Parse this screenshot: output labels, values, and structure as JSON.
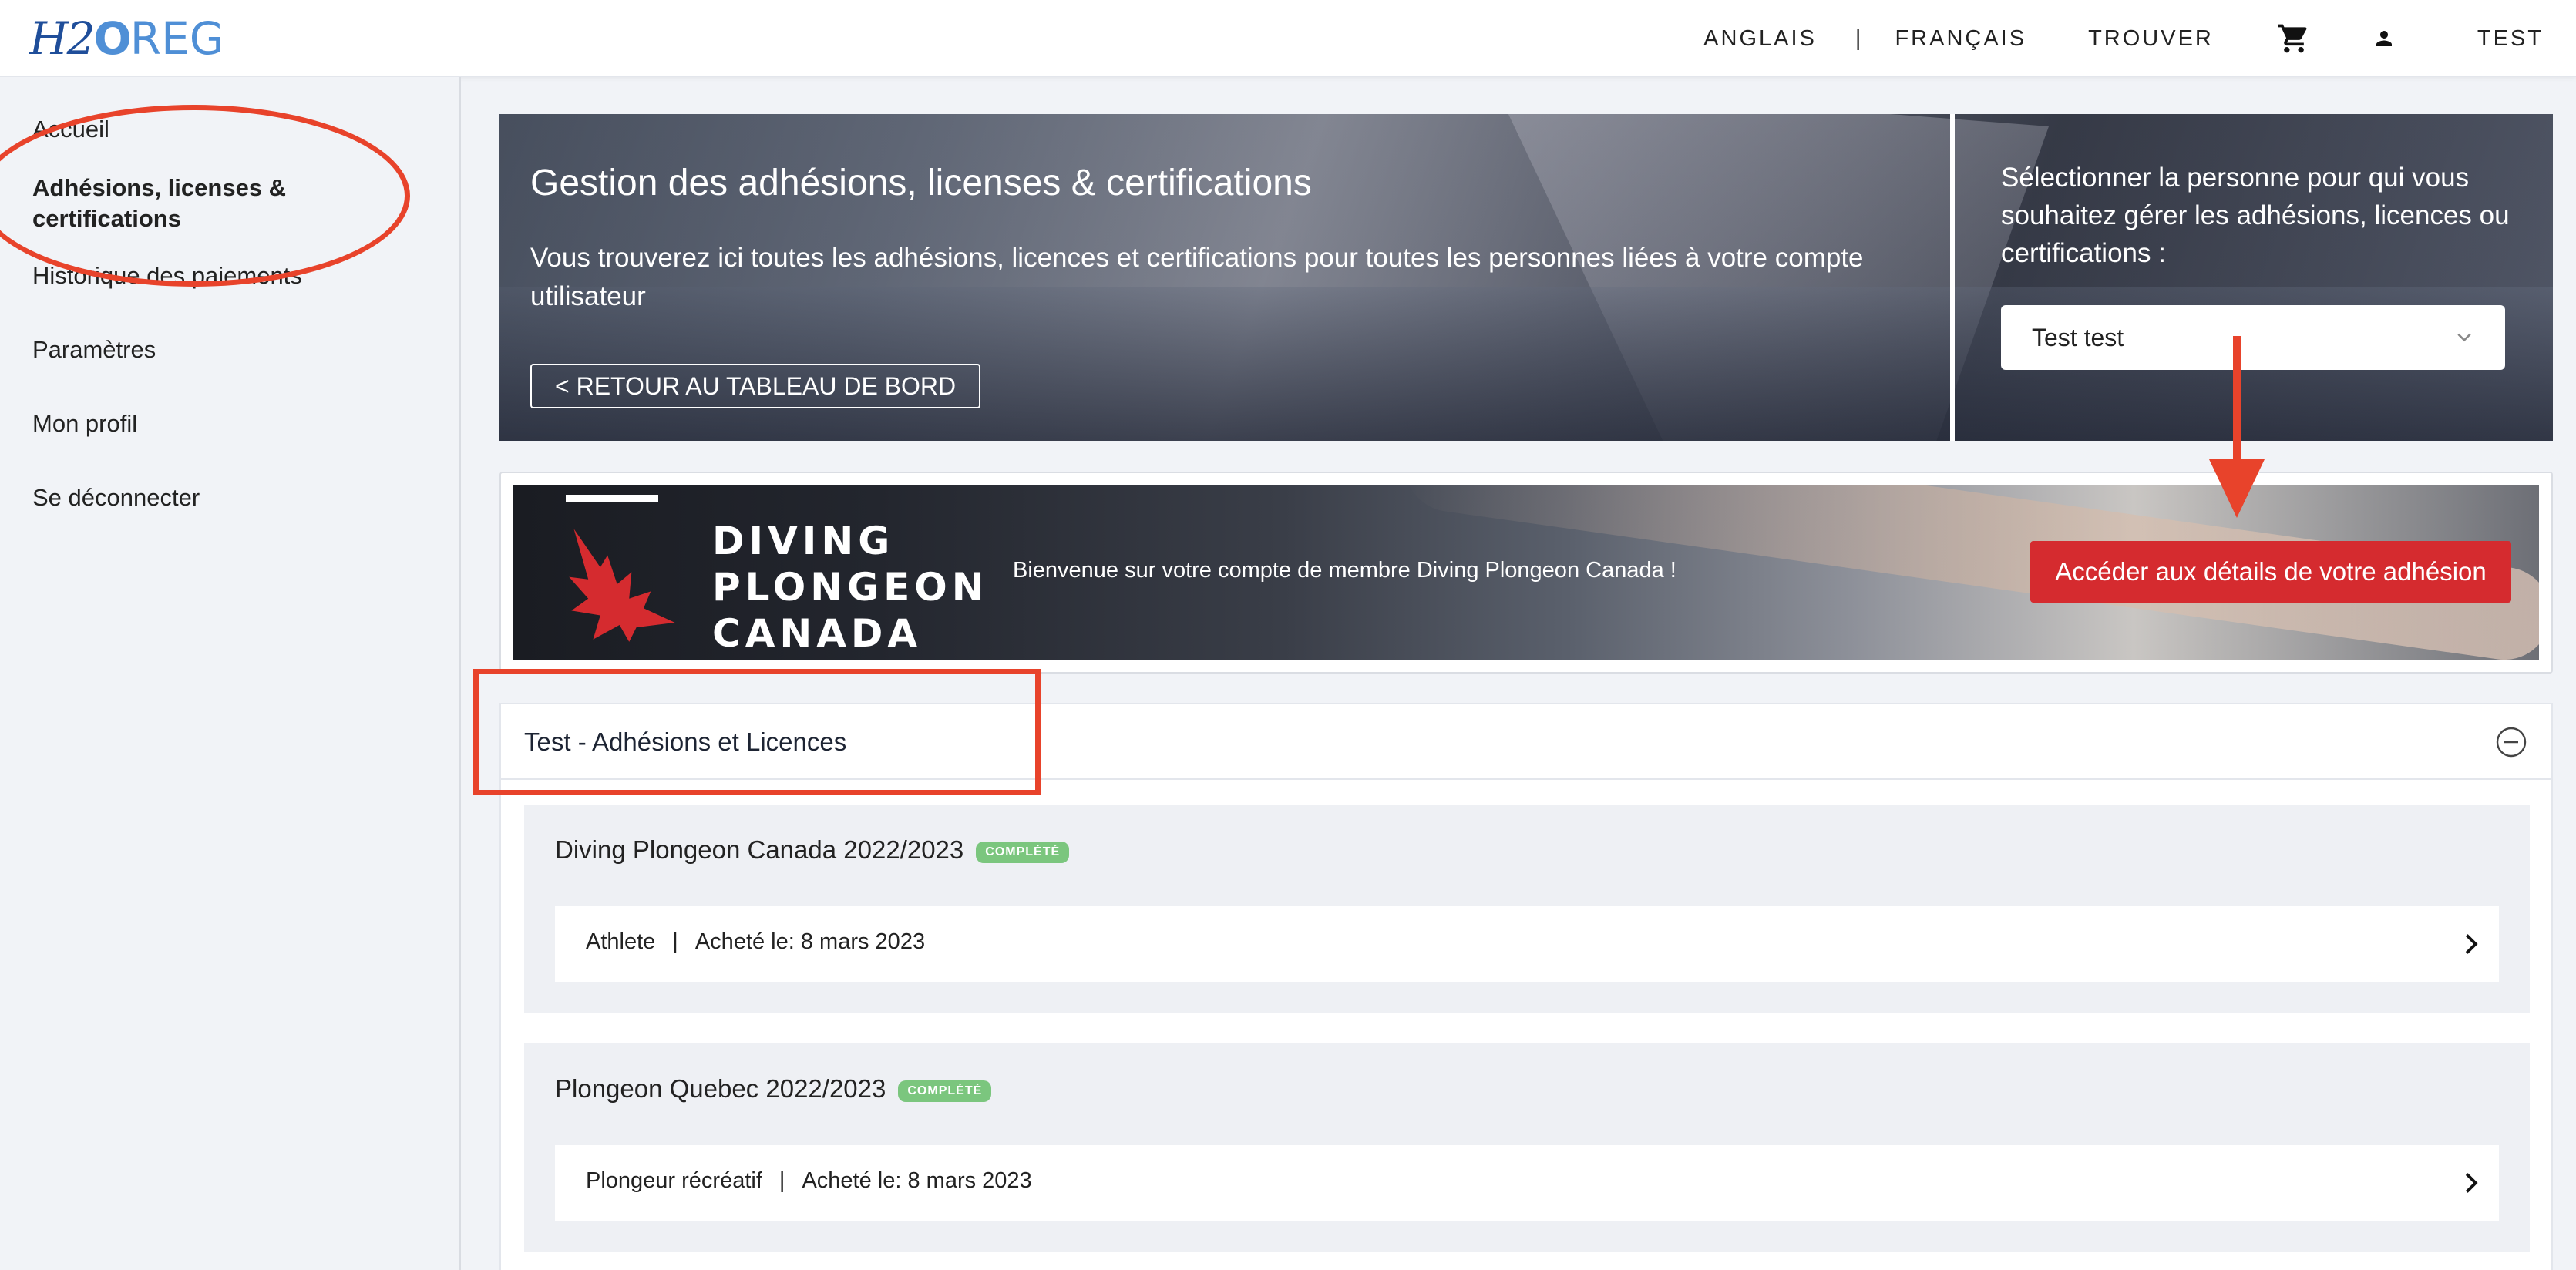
{
  "header": {
    "logo_text_h": "H2",
    "logo_text_o": "O",
    "logo_text_reg": "REG",
    "nav": {
      "anglais": "ANGLAIS",
      "separator": "|",
      "francais": "FRANÇAIS",
      "trouver": "TROUVER",
      "user": "TEST"
    },
    "cart_icon": "shopping-cart-icon",
    "user_icon": "person-icon"
  },
  "sidebar": {
    "items": [
      {
        "label": "Accueil"
      },
      {
        "label": "Adhésions, licenses & certifications"
      },
      {
        "label": "Historique des paiements"
      },
      {
        "label": "Paramètres"
      },
      {
        "label": "Mon profil"
      },
      {
        "label": "Se déconnecter"
      }
    ]
  },
  "banner": {
    "title": "Gestion des adhésions, licenses & certifications",
    "description": "Vous trouverez ici toutes les adhésions, licences et certifications pour toutes les personnes liées à votre compte utilisateur",
    "back_button": "< RETOUR AU TABLEAU DE BORD",
    "select_prompt": "Sélectionner la personne pour qui vous souhaitez gérer les adhésions, licences ou certifications :",
    "select_value": "Test test"
  },
  "diving": {
    "brand_line1": "DIVING",
    "brand_line2": "PLONGEON",
    "brand_line3": "CANADA",
    "welcome": "Bienvenue sur votre compte de membre Diving Plongeon Canada !",
    "cta": "Accéder aux détails de votre adhésion"
  },
  "memberships": {
    "title": "Test - Adhésions et Licences",
    "items": [
      {
        "name": "Diving Plongeon Canada 2022/2023",
        "badge": "COMPLÉTÉ",
        "role": "Athlete",
        "purchased": "Acheté le: 8 mars 2023"
      },
      {
        "name": "Plongeon Quebec 2022/2023",
        "badge": "COMPLÉTÉ",
        "role": "Plongeur récréatif",
        "purchased": "Acheté le: 8 mars 2023"
      }
    ],
    "separator": "|"
  },
  "colors": {
    "accent_red": "#d52b2f",
    "badge_green": "#7bc67e",
    "annotation": "#e8432b",
    "logo_blue": "#4f8fd6"
  }
}
